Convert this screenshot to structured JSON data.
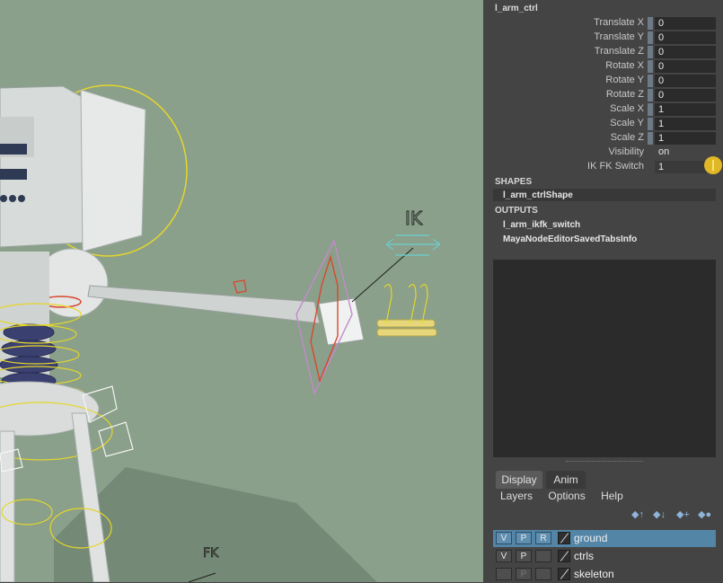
{
  "viewport": {
    "ik_label": "IK",
    "fk_label": "FK"
  },
  "attribute_editor": {
    "node_name": "l_arm_ctrl",
    "attributes": [
      {
        "label": "Translate X",
        "value": "0"
      },
      {
        "label": "Translate Y",
        "value": "0"
      },
      {
        "label": "Translate Z",
        "value": "0"
      },
      {
        "label": "Rotate X",
        "value": "0"
      },
      {
        "label": "Rotate Y",
        "value": "0"
      },
      {
        "label": "Rotate Z",
        "value": "0"
      },
      {
        "label": "Scale X",
        "value": "1"
      },
      {
        "label": "Scale Y",
        "value": "1"
      },
      {
        "label": "Scale Z",
        "value": "1"
      },
      {
        "label": "Visibility",
        "value": "on"
      },
      {
        "label": "IK FK Switch",
        "value": "1"
      }
    ],
    "shapes_heading": "SHAPES",
    "shapes": [
      "l_arm_ctrlShape"
    ],
    "outputs_heading": "OUTPUTS",
    "outputs": [
      "l_arm_ikfk_switch",
      "MayaNodeEditorSavedTabsInfo"
    ]
  },
  "layer_editor": {
    "tabs": [
      "Display",
      "Anim"
    ],
    "menus": [
      "Layers",
      "Options",
      "Help"
    ],
    "layers": [
      {
        "v": "V",
        "p": "P",
        "r": "R",
        "name": "ground",
        "selected": true
      },
      {
        "v": "V",
        "p": "P",
        "r": "",
        "name": "ctrls",
        "selected": false
      },
      {
        "v": "",
        "p": "P",
        "r": "",
        "name": "skeleton",
        "selected": false
      }
    ]
  },
  "colors": {
    "viewport_bg": "#8aa08a",
    "selection": "#5285a6",
    "keyed": "#e0b726",
    "ik_control": "#cc3a2a",
    "fk_control": "#e0d12a"
  }
}
